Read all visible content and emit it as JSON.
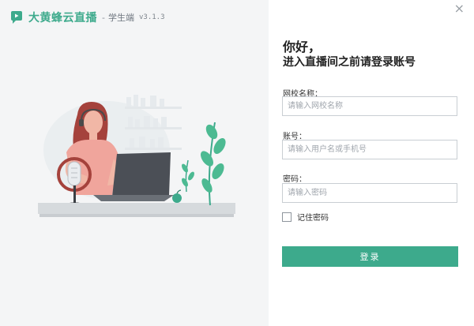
{
  "app": {
    "name": "大黄蜂云直播",
    "separator": "-",
    "subtitle": "学生端",
    "version": "v3.1.3"
  },
  "window": {
    "close_symbol": "×"
  },
  "login": {
    "greeting": "你好，",
    "heading": "进入直播间之前请登录账号",
    "school": {
      "label": "网校名称：",
      "placeholder": "请输入网校名称",
      "value": ""
    },
    "account": {
      "label": "账号：",
      "placeholder": "请输入用户名或手机号",
      "value": ""
    },
    "password": {
      "label": "密码：",
      "placeholder": "请输入密码",
      "value": ""
    },
    "remember_label": "记住密码",
    "remember_checked": false,
    "submit_label": "登录"
  },
  "theme": {
    "accent": "#3daa8c",
    "left_panel_bg": "#f4f5f6"
  },
  "icons": {
    "logo": "app-logo-icon",
    "close": "close-icon",
    "illustration": "student-laptop-microphone-illustration"
  }
}
